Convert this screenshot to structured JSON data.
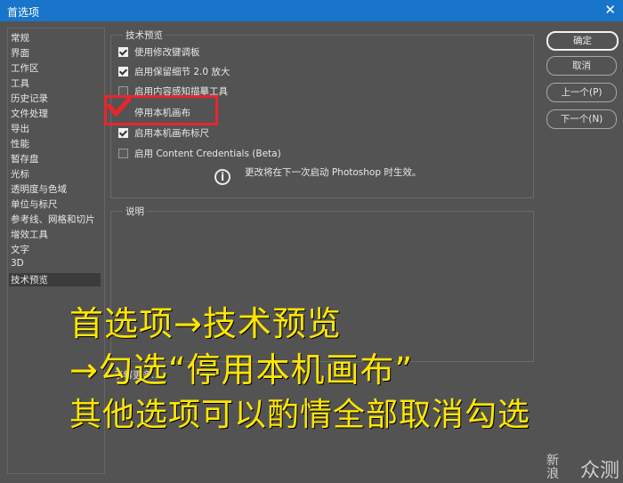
{
  "window": {
    "title": "首选项"
  },
  "sidebar": {
    "items": [
      "常规",
      "界面",
      "工作区",
      "工具",
      "历史记录",
      "文件处理",
      "导出",
      "性能",
      "暂存盘",
      "光标",
      "透明度与色域",
      "单位与标尺",
      "参考线、网格和切片",
      "增效工具",
      "文字",
      "3D",
      "技术预览"
    ],
    "selected": "技术预览"
  },
  "panel": {
    "title": "技术预览",
    "options": [
      {
        "label": "使用修改键调板",
        "checked": true
      },
      {
        "label": "启用保留细节 2.0 放大",
        "checked": true
      },
      {
        "label": "启用内容感知描摹工具",
        "checked": false
      },
      {
        "label": "停用本机画布",
        "checked": true
      },
      {
        "label": "启用本机画布标尺",
        "checked": true
      },
      {
        "label": "启用 Content Credentials (Beta)",
        "checked": false
      }
    ],
    "info_icon": "i",
    "info_text": "更改将在下一次启动 Photoshop 时生效。"
  },
  "description": {
    "title": "说明",
    "learn_more": "了解更多..."
  },
  "buttons": {
    "ok": "确定",
    "cancel": "取消",
    "prev": "上一个(P)",
    "next": "下一个(N)"
  },
  "annotation": {
    "line1": "首选项→技术预览",
    "line2": "→勾选“停用本机画布”",
    "line3": "其他选项可以酌情全部取消勾选",
    "color": "#ffe600",
    "highlight_color": "#e8262c"
  },
  "watermark": {
    "small": "新浪",
    "big": "众测"
  }
}
